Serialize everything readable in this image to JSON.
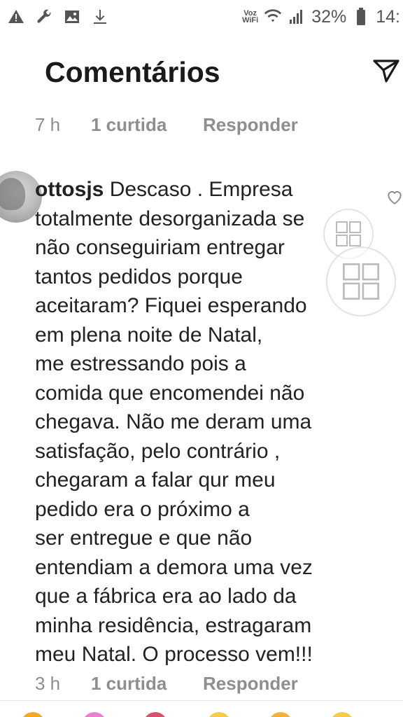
{
  "status_bar": {
    "left_icons": [
      "warning-icon",
      "wrench-icon",
      "image-icon",
      "download-icon"
    ],
    "voz_wifi": [
      "Voz",
      "WiFi"
    ],
    "battery_percent": "32%",
    "clock": "14:"
  },
  "header": {
    "title": "Comentários",
    "send_icon": "send-icon"
  },
  "previous_comment_meta": {
    "time": "7 h",
    "likes": "1 curtida",
    "reply": "Responder"
  },
  "comment": {
    "username": "ottosjs",
    "text": "Descaso . Empresa\ntotalmente desorganizada se\nnão conseguiriam entregar\ntantos pedidos porque\naceitaram? Fiquei esperando\nem plena noite de Natal,\nme estressando pois a\ncomida que encomendei não\nchegava. Não me deram uma\nsatisfação, pelo contrário ,\nchegaram a falar qur meu\npedido era o próximo  a\nser entregue e  que não\nentendiam a demora uma vez\nque a fábrica  era ao lado da\nminha residência,  estragaram\nmeu Natal.  O processo vem!!!",
    "time": "3 h",
    "likes": "1 curtida",
    "reply": "Responder"
  },
  "colors": {
    "meta_gray": "#8e8e8e",
    "text": "#222222"
  }
}
